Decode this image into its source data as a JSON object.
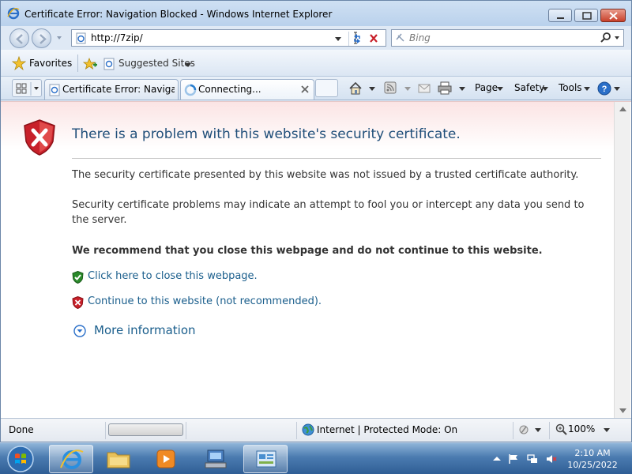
{
  "window": {
    "title": "Certificate Error: Navigation Blocked - Windows Internet Explorer"
  },
  "address_bar": {
    "url": "http://7zip/"
  },
  "search": {
    "placeholder": "Bing"
  },
  "favorites_bar": {
    "favorites_label": "Favorites",
    "suggested_label": "Suggested Sites"
  },
  "tabs": [
    {
      "label": "Certificate Error: Navigati..."
    },
    {
      "label": "Connecting..."
    }
  ],
  "command_bar": {
    "page_label": "Page",
    "safety_label": "Safety",
    "tools_label": "Tools"
  },
  "page": {
    "title": "There is a problem with this website's security certificate.",
    "paragraph1": "The security certificate presented by this website was not issued by a trusted certificate authority.",
    "paragraph2": "Security certificate problems may indicate an attempt to fool you or intercept any data you send to the server.",
    "recommendation": "We recommend that you close this webpage and do not continue to this website.",
    "close_link": "Click here to close this webpage.",
    "continue_link": "Continue to this website (not recommended).",
    "more_info": "More information"
  },
  "status_bar": {
    "status": "Done",
    "zone": "Internet | Protected Mode: On",
    "zoom": "100%"
  },
  "taskbar": {
    "time": "2:10 AM",
    "date": "10/25/2022"
  },
  "colors": {
    "link": "#1a5e8c",
    "title_blue": "#1f4e79",
    "error_red": "#c8202a",
    "ok_green": "#2a8a2a"
  }
}
